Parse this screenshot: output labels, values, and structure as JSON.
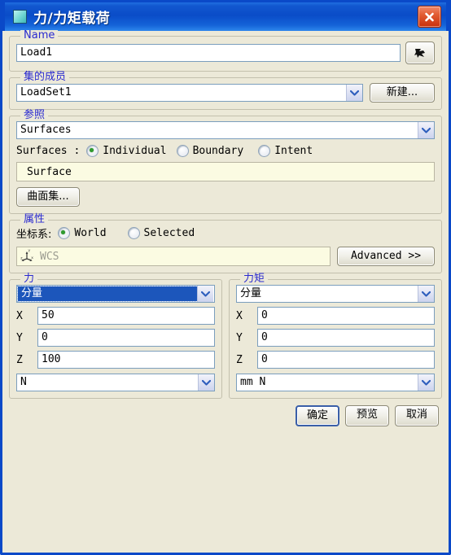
{
  "window": {
    "title": "力/力矩载荷",
    "icon": "window-icon",
    "close_label": "×"
  },
  "name_group": {
    "legend": "Name",
    "value": "Load1",
    "icon_button": "select-arrow-icon"
  },
  "member_group": {
    "legend": "集的成员",
    "value": "LoadSet1",
    "new_button": "新建..."
  },
  "reference_group": {
    "legend": "参照",
    "type_value": "Surfaces",
    "subtype_label": "Surfaces :",
    "options": [
      {
        "label": "Individual",
        "checked": true
      },
      {
        "label": "Boundary",
        "checked": false
      },
      {
        "label": "Intent",
        "checked": false
      }
    ],
    "list_items": [
      "Surface"
    ],
    "surface_set_button": "曲面集..."
  },
  "properties_group": {
    "legend": "属性",
    "csys_label": "坐标系:",
    "options": [
      {
        "label": "World",
        "checked": true
      },
      {
        "label": "Selected",
        "checked": false
      }
    ],
    "csys_placeholder": "WCS",
    "csys_icon": "coordinate-system-icon",
    "advanced_button": "Advanced >>"
  },
  "force_group": {
    "legend": "力",
    "mode": "分量",
    "axes": [
      {
        "label": "X",
        "value": "50"
      },
      {
        "label": "Y",
        "value": "0"
      },
      {
        "label": "Z",
        "value": "100"
      }
    ],
    "unit": "N"
  },
  "moment_group": {
    "legend": "力矩",
    "mode": "分量",
    "axes": [
      {
        "label": "X",
        "value": "0"
      },
      {
        "label": "Y",
        "value": "0"
      },
      {
        "label": "Z",
        "value": "0"
      }
    ],
    "unit": "mm N"
  },
  "footer": {
    "ok": "确定",
    "preview": "预览",
    "cancel": "取消"
  },
  "colors": {
    "titlebar": "#0a4cc8",
    "dialog_bg": "#ece9d8",
    "legend_text": "#2a2ad0",
    "radio_dot": "#2f9b2f",
    "selection": "#1c56bb",
    "list_bg": "#fbfbe2",
    "close_button": "#c8300c"
  }
}
